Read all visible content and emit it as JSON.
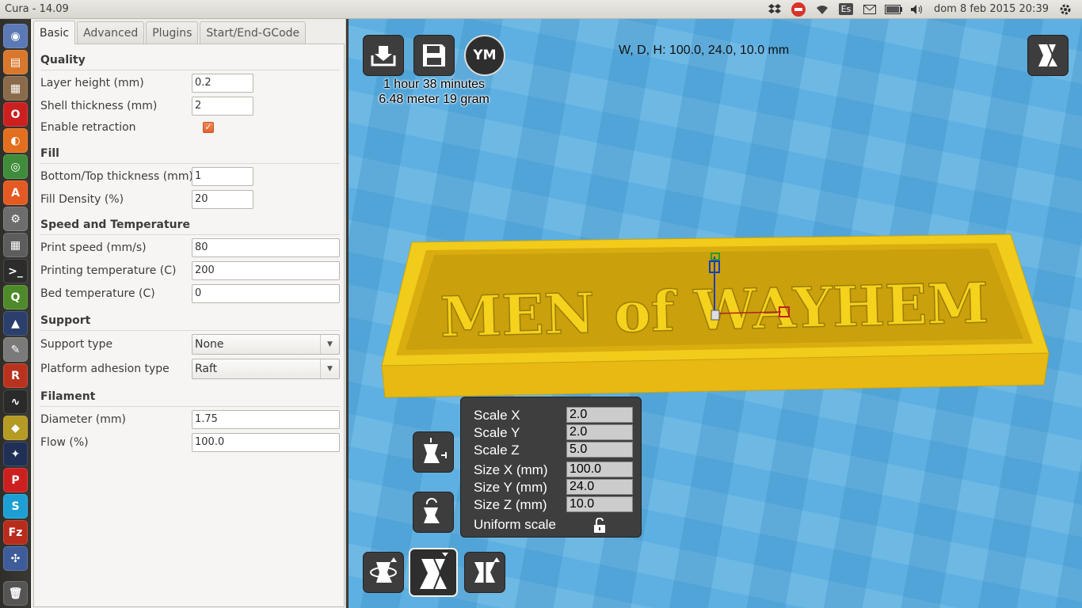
{
  "window": {
    "title": "Cura - 14.09"
  },
  "tray": {
    "keyboard_layout": "Es",
    "date_time": "dom  8 feb 2015 20:39"
  },
  "tabs": [
    {
      "label": "Basic"
    },
    {
      "label": "Advanced"
    },
    {
      "label": "Plugins"
    },
    {
      "label": "Start/End-GCode"
    }
  ],
  "settings": {
    "quality": {
      "title": "Quality",
      "layer_height": {
        "label": "Layer height (mm)",
        "value": "0.2"
      },
      "shell_thickness": {
        "label": "Shell thickness (mm)",
        "value": "2"
      },
      "enable_retraction": {
        "label": "Enable retraction",
        "checked": true
      }
    },
    "fill": {
      "title": "Fill",
      "bottom_top_thickness": {
        "label": "Bottom/Top thickness (mm)",
        "value": "1"
      },
      "fill_density": {
        "label": "Fill Density (%)",
        "value": "20"
      }
    },
    "speed": {
      "title": "Speed and Temperature",
      "print_speed": {
        "label": "Print speed (mm/s)",
        "value": "80"
      },
      "printing_temperature": {
        "label": "Printing temperature (C)",
        "value": "200"
      },
      "bed_temperature": {
        "label": "Bed temperature (C)",
        "value": "0"
      }
    },
    "support": {
      "title": "Support",
      "support_type": {
        "label": "Support type",
        "value": "None"
      },
      "platform_adhesion": {
        "label": "Platform adhesion type",
        "value": "Raft"
      }
    },
    "filament": {
      "title": "Filament",
      "diameter": {
        "label": "Diameter (mm)",
        "value": "1.75"
      },
      "flow": {
        "label": "Flow (%)",
        "value": "100.0"
      }
    }
  },
  "viewport": {
    "ym_label": "YM",
    "print_time": "1 hour 38 minutes",
    "print_material": "6.48 meter 19 gram",
    "dimensions": "W, D, H: 100.0, 24.0, 10.0 mm",
    "model_text": "MEN of WAYHEM",
    "model_color": "#f5d21c"
  },
  "scale_panel": {
    "scale_x": {
      "label": "Scale X",
      "value": "2.0"
    },
    "scale_y": {
      "label": "Scale Y",
      "value": "2.0"
    },
    "scale_z": {
      "label": "Scale Z",
      "value": "5.0"
    },
    "size_x": {
      "label": "Size X (mm)",
      "value": "100.0"
    },
    "size_y": {
      "label": "Size Y (mm)",
      "value": "24.0"
    },
    "size_z": {
      "label": "Size Z (mm)",
      "value": "10.0"
    },
    "uniform_scale": {
      "label": "Uniform scale"
    }
  },
  "icons": {
    "launcher": [
      "ubuntu-dash-icon",
      "files-icon",
      "archive-icon",
      "opera-icon",
      "firefox-icon",
      "chrome-icon",
      "software-center-icon",
      "settings-icon",
      "calculator-icon",
      "terminal-icon",
      "qgis-icon",
      "inkscape-icon",
      "text-editor-icon",
      "reader-icon",
      "system-monitor-icon",
      "cura-icon",
      "stellarium-icon",
      "pdf-icon",
      "skype-icon",
      "filezilla-icon",
      "network-icon",
      "trash-icon"
    ]
  }
}
